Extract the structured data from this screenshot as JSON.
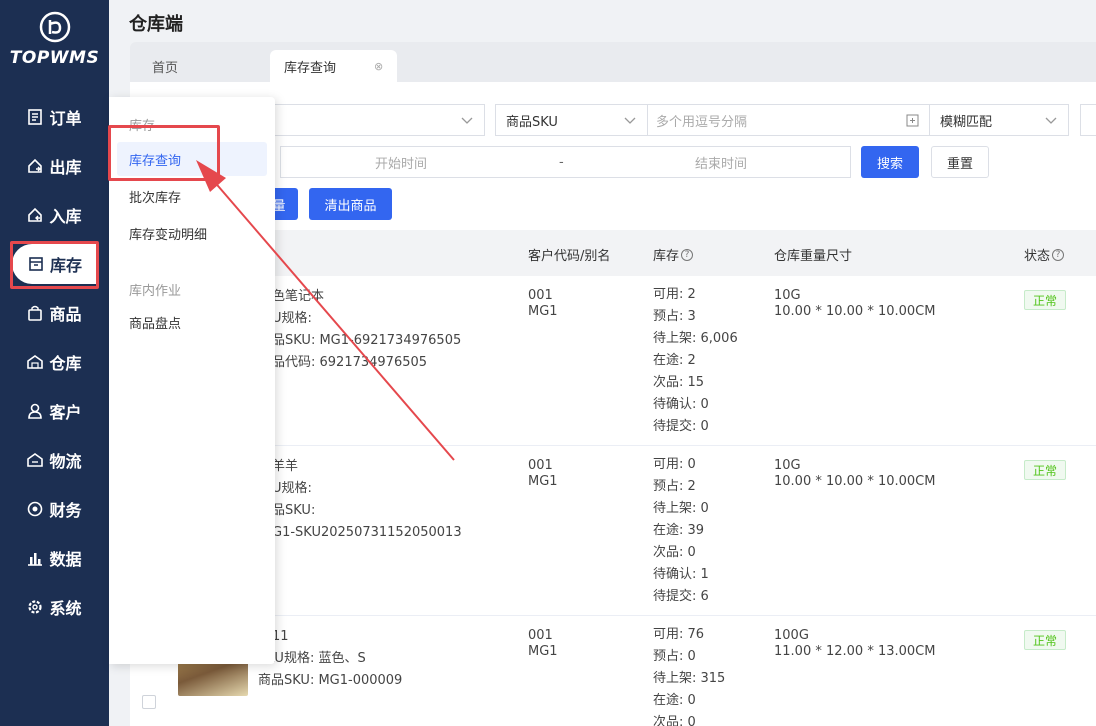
{
  "app": {
    "brand": "TOPWMS",
    "title": "仓库端"
  },
  "sidebar": {
    "items": [
      {
        "label": "订单",
        "icon": "order-icon"
      },
      {
        "label": "出库",
        "icon": "outbound-icon"
      },
      {
        "label": "入库",
        "icon": "inbound-icon"
      },
      {
        "label": "库存",
        "icon": "inventory-icon",
        "active": true
      },
      {
        "label": "商品",
        "icon": "product-icon"
      },
      {
        "label": "仓库",
        "icon": "warehouse-icon"
      },
      {
        "label": "客户",
        "icon": "customer-icon"
      },
      {
        "label": "物流",
        "icon": "logistics-icon"
      },
      {
        "label": "财务",
        "icon": "finance-icon"
      },
      {
        "label": "数据",
        "icon": "data-icon"
      },
      {
        "label": "系统",
        "icon": "system-icon"
      }
    ]
  },
  "tabs": [
    {
      "label": "首页"
    },
    {
      "label": "库存查询",
      "active": true,
      "close": "⊗"
    }
  ],
  "submenu": {
    "groups": [
      {
        "title": "库存",
        "items": [
          "库存查询",
          "批次库存",
          "库存变动明细"
        ]
      },
      {
        "title": "库内作业",
        "items": [
          "商品盘点"
        ]
      }
    ]
  },
  "filters": {
    "sku_type": "商品SKU",
    "sku_placeholder": "多个用逗号分隔",
    "match_mode": "模糊匹配",
    "start_time": "开始时间",
    "range_sep": "-",
    "end_time": "结束时间",
    "search": "搜索",
    "reset": "重置",
    "action_partial": "量",
    "clear_products": "清出商品"
  },
  "table": {
    "headers": {
      "customer": "客户代码/别名",
      "stock": "库存",
      "weight_size": "仓库重量尺寸",
      "status": "状态"
    },
    "rows": [
      {
        "product_lines": [
          "色笔记本",
          "U规格:",
          "品SKU:  MG1-6921734976505",
          "品代码:  6921734976505"
        ],
        "customer_code": "001",
        "customer_alias": "MG1",
        "stock": [
          "可用:  2",
          "预占:  3",
          "待上架:  6,006",
          "在途:  2",
          "次品:  15",
          "待确认:  0",
          "待提交:  0"
        ],
        "weight": "10G",
        "size": "10.00 * 10.00 * 10.00CM",
        "status": "正常"
      },
      {
        "product_lines": [
          "羊羊",
          "U规格:",
          "品SKU:",
          "G1-SKU20250731152050013"
        ],
        "customer_code": "001",
        "customer_alias": "MG1",
        "stock": [
          "可用:  0",
          "预占:  2",
          "待上架:  0",
          "在途:  39",
          "次品:  0",
          "待确认:  1",
          "待提交:  6"
        ],
        "weight": "10G",
        "size": "10.00 * 10.00 * 10.00CM",
        "status": "正常"
      },
      {
        "product_lines": [
          "11",
          "SKU规格:  蓝色、S",
          "商品SKU:  MG1-000009"
        ],
        "customer_code": "001",
        "customer_alias": "MG1",
        "stock": [
          "可用:  76",
          "预占:  0",
          "待上架:  315",
          "在途:  0",
          "次品:  0"
        ],
        "weight": "100G",
        "size": "11.00 * 12.00 * 13.00CM",
        "status": "正常"
      }
    ]
  },
  "colors": {
    "sidebar_bg": "#1c2f52",
    "primary": "#3366f0",
    "annotation": "#e5484d",
    "status_ok": "#52c41a"
  }
}
